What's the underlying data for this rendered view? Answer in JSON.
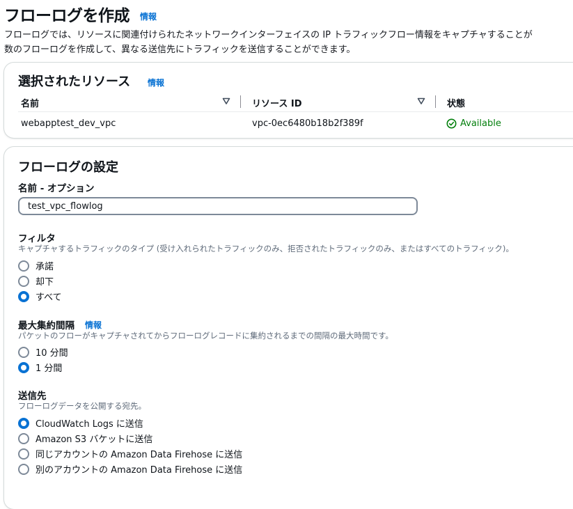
{
  "page": {
    "title": "フローログを作成",
    "info_label": "情報",
    "description_line1": "フローログでは、リソースに関連付けられたネットワークインターフェイスの IP トラフィックフロー情報をキャプチャすることが",
    "description_line2": "数のフローログを作成して、異なる送信先にトラフィックを送信することができます。"
  },
  "resources": {
    "title": "選択されたリソース",
    "info_label": "情報",
    "columns": [
      "名前",
      "リソース ID",
      "状態"
    ],
    "row": {
      "name": "webapptest_dev_vpc",
      "resource_id": "vpc-0ec6480b18b2f389f",
      "status": "Available"
    },
    "status_color": "#037f0c"
  },
  "settings": {
    "title": "フローログの設定",
    "name_label": "名前 - オプション",
    "name_value": "test_vpc_flowlog",
    "filter": {
      "label": "フィルタ",
      "description": "キャプチャするトラフィックのタイプ (受け入れられたトラフィックのみ、拒否されたトラフィックのみ、またはすべてのトラフィック)。",
      "options": [
        "承諾",
        "却下",
        "すべて"
      ],
      "selected": "すべて"
    },
    "interval": {
      "label": "最大集約間隔",
      "info_label": "情報",
      "description": "パケットのフローがキャプチャされてからフローログレコードに集約されるまでの間隔の最大時間です。",
      "options": [
        "10 分間",
        "1 分間"
      ],
      "selected": "1 分間"
    },
    "destination": {
      "label": "送信先",
      "description": "フローログデータを公開する宛先。",
      "options": [
        "CloudWatch Logs に送信",
        "Amazon S3 バケットに送信",
        "同じアカウントの Amazon Data Firehose に送信",
        "別のアカウントの Amazon Data Firehose に送信"
      ],
      "selected": "CloudWatch Logs に送信"
    }
  },
  "colors": {
    "accent": "#0972d3",
    "success": "#037f0c"
  }
}
